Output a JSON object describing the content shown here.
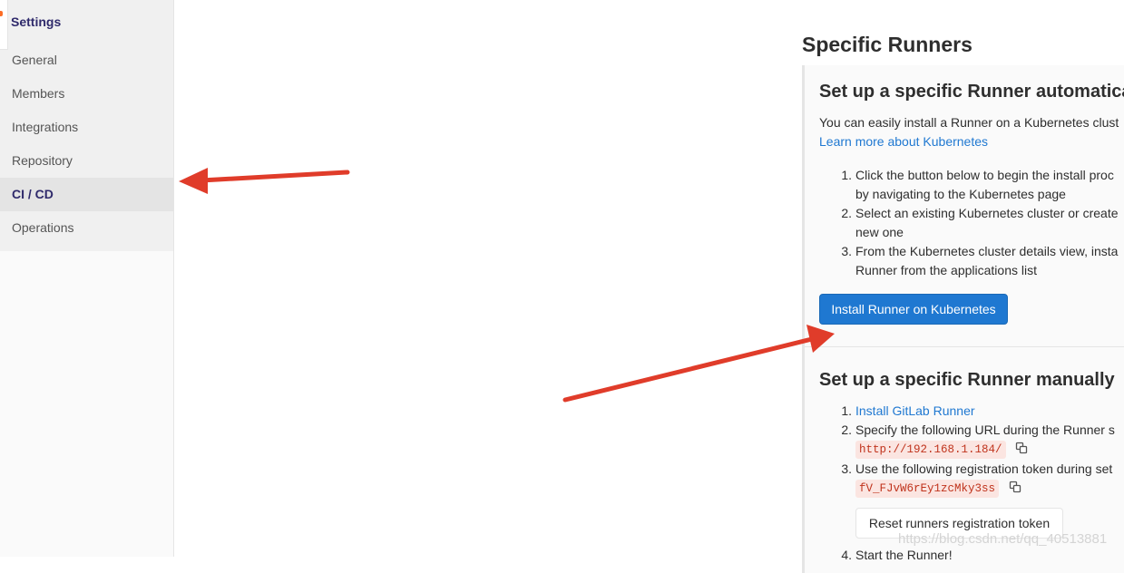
{
  "sidebar": {
    "title": "Settings",
    "items": [
      {
        "label": "General"
      },
      {
        "label": "Members"
      },
      {
        "label": "Integrations"
      },
      {
        "label": "Repository"
      },
      {
        "label": "CI / CD"
      },
      {
        "label": "Operations"
      }
    ],
    "active_index": 4
  },
  "main": {
    "title": "Specific Runners",
    "auto": {
      "heading": "Set up a specific Runner automatica",
      "intro": "You can easily install a Runner on a Kubernetes clust",
      "learn_more": "Learn more about Kubernetes",
      "steps": [
        {
          "num": "1.",
          "line1": "Click the button below to begin the install proc",
          "line2": "by navigating to the Kubernetes page"
        },
        {
          "num": "2.",
          "line1": "Select an existing Kubernetes cluster or create",
          "line2": "new one"
        },
        {
          "num": "3.",
          "line1": "From the Kubernetes cluster details view, insta",
          "line2": "Runner from the applications list"
        }
      ],
      "install_button": "Install Runner on Kubernetes"
    },
    "manual": {
      "heading": "Set up a specific Runner manually",
      "step1_num": "1.",
      "step1_link": "Install GitLab Runner",
      "step2_num": "2.",
      "step2_text": "Specify the following URL during the Runner s",
      "url": "http://192.168.1.184/",
      "step3_num": "3.",
      "step3_text": "Use the following registration token during set",
      "token": "fV_FJvW6rEy1zcMky3ss",
      "reset_button": "Reset runners registration token",
      "step4_num": "4.",
      "step4_text": "Start the Runner!"
    }
  },
  "watermark": "https://blog.csdn.net/qq_40513881",
  "colors": {
    "accent_link": "#1f78d1",
    "primary_button": "#1f78d1",
    "arrow": "#e03c2a",
    "code_text": "#c0341d"
  }
}
